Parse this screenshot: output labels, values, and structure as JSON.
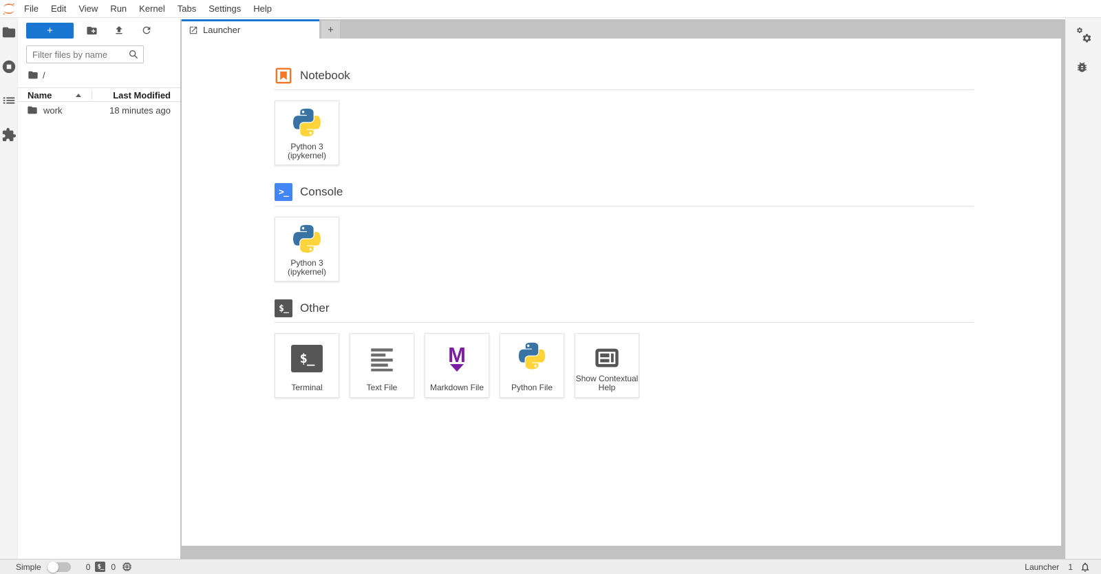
{
  "menubar": {
    "items": [
      "File",
      "Edit",
      "View",
      "Run",
      "Kernel",
      "Tabs",
      "Settings",
      "Help"
    ]
  },
  "file_browser": {
    "new_button": "+",
    "filter_placeholder": "Filter files by name",
    "breadcrumb_root": "/",
    "header": {
      "name": "Name",
      "last_modified": "Last Modified"
    },
    "rows": [
      {
        "name": "work",
        "modified": "18 minutes ago"
      }
    ]
  },
  "tab_bar": {
    "active_tab": "Launcher",
    "add_tab": "+"
  },
  "launcher": {
    "notebook": {
      "title": "Notebook",
      "card": {
        "label": "Python 3 (ipykernel)"
      }
    },
    "console": {
      "title": "Console",
      "card": {
        "label": "Python 3 (ipykernel)"
      }
    },
    "other": {
      "title": "Other",
      "cards": [
        {
          "label": "Terminal"
        },
        {
          "label": "Text File"
        },
        {
          "label": "Markdown File"
        },
        {
          "label": "Python File"
        },
        {
          "label": "Show Contextual Help"
        }
      ]
    }
  },
  "icons": {
    "terminal_glyph": "$_",
    "console_glyph": ">_",
    "markdown_letter": "M"
  },
  "status_bar": {
    "mode_label": "Simple",
    "terminals_count": "0",
    "kernels_count": "0",
    "activity_label": "Launcher",
    "notifications_count": "1"
  },
  "colors": {
    "accent_blue": "#1976d2",
    "jupyter_orange": "#f37726",
    "console_blue": "#4285f4",
    "markdown_purple": "#7b1fa2",
    "dark_icon": "#555555",
    "tab_strip_gray": "#c2c2c2"
  }
}
